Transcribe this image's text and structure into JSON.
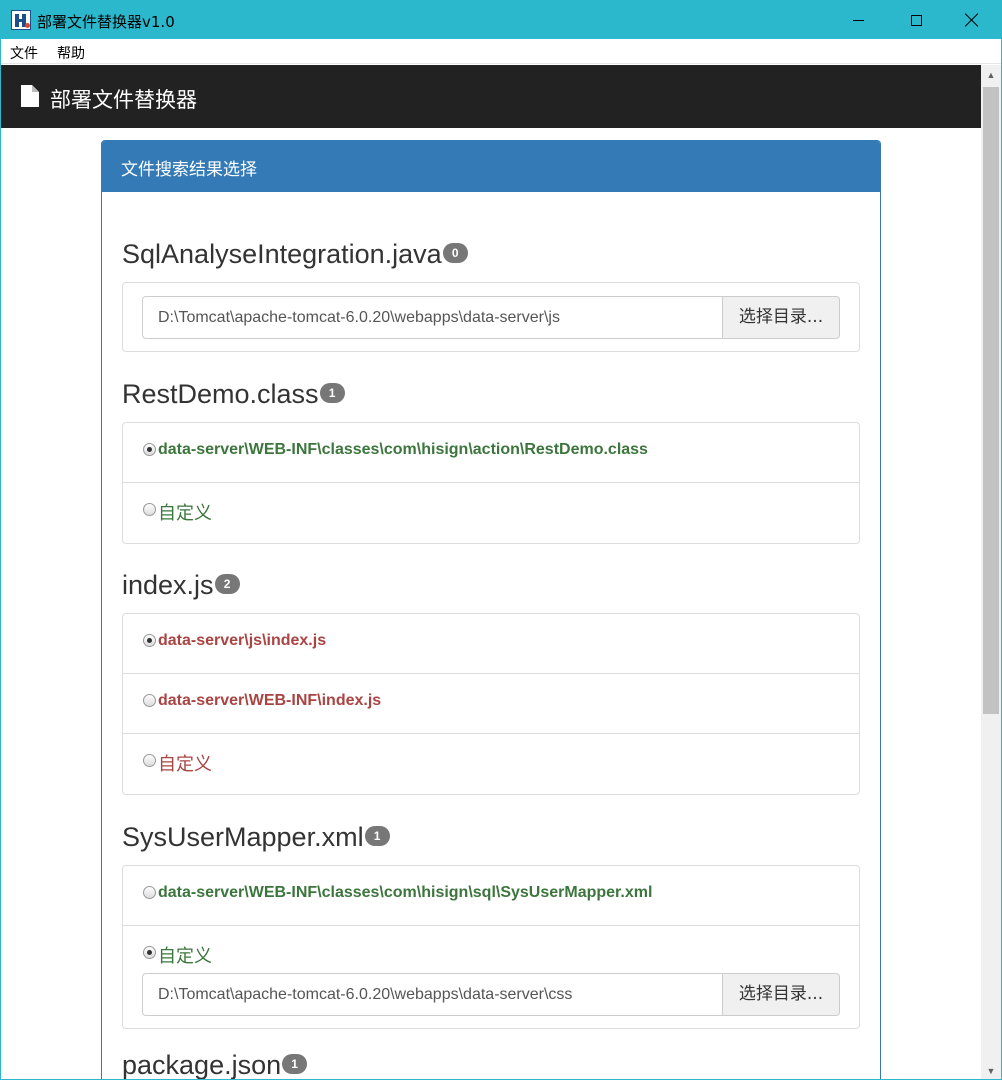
{
  "window": {
    "title": "部署文件替换器v1.0"
  },
  "menu": {
    "file": "文件",
    "help": "帮助"
  },
  "navbar": {
    "title": "部署文件替换器"
  },
  "panel": {
    "heading": "文件搜索结果选择",
    "choose_button": "选择目录...",
    "groups": [
      {
        "name": "SqlAnalyseIntegration.java",
        "count": "0",
        "path": "D:\\Tomcat\\apache-tomcat-6.0.20\\webapps\\data-server\\js"
      },
      {
        "name": "RestDemo.class",
        "count": "1",
        "options": [
          {
            "label": "data-server\\WEB-INF\\classes\\com\\hisign\\action\\RestDemo.class",
            "checked": true
          },
          {
            "label": "自定义",
            "checked": false
          }
        ]
      },
      {
        "name": "index.js",
        "count": "2",
        "options": [
          {
            "label": "data-server\\js\\index.js",
            "checked": true
          },
          {
            "label": "data-server\\WEB-INF\\index.js",
            "checked": false
          },
          {
            "label": "自定义",
            "checked": false
          }
        ]
      },
      {
        "name": "SysUserMapper.xml",
        "count": "1",
        "options": [
          {
            "label": "data-server\\WEB-INF\\classes\\com\\hisign\\sql\\SysUserMapper.xml",
            "checked": false
          },
          {
            "label": "自定义",
            "checked": true
          }
        ],
        "path": "D:\\Tomcat\\apache-tomcat-6.0.20\\webapps\\data-server\\css"
      },
      {
        "name": "package.json",
        "count": "1"
      }
    ]
  },
  "colors": {
    "titlebar": "#2bb8cc",
    "panel_primary": "#337ab7",
    "success_text": "#3c763d",
    "danger_text": "#a94442",
    "navbar": "#222222"
  }
}
